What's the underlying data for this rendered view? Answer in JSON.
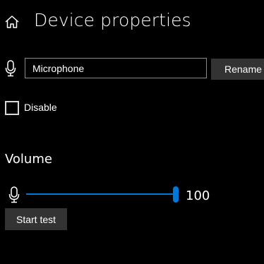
{
  "header": {
    "title": "Device properties",
    "home_icon": "home-icon"
  },
  "name_field": {
    "icon": "microphone-icon",
    "value": "Microphone",
    "rename_label": "Rename"
  },
  "disable": {
    "label": "Disable",
    "checked": false
  },
  "volume": {
    "heading": "Volume",
    "icon": "microphone-icon",
    "value": 100,
    "value_text": "100",
    "max": 100,
    "start_test_label": "Start test"
  },
  "colors": {
    "background": "#000000",
    "accent": "#0078d7",
    "button": "#333333",
    "input_border": "#8a8a8a",
    "text": "#ffffff"
  }
}
